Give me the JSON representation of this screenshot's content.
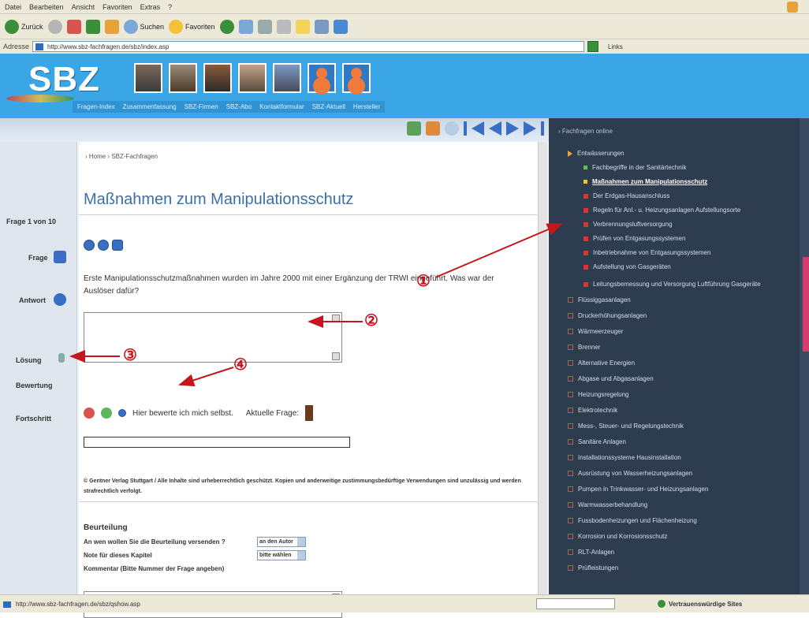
{
  "browser": {
    "menu_items": [
      "Datei",
      "Bearbeiten",
      "Ansicht",
      "Favoriten",
      "Extras",
      "?"
    ],
    "toolbar": {
      "back_label": "Zurück",
      "search_label": "Suchen",
      "favorites_label": "Favoriten"
    },
    "address_label": "Adresse",
    "address_value": "http://www.sbz-fachfragen.de/sbz/index.asp",
    "links_label": "Links",
    "status_url": "http://www.sbz-fachfragen.de/sbz/qshow.asp",
    "status_zone": "Vertrauenswürdige Sites"
  },
  "header": {
    "logo": "SBZ",
    "nav": [
      "Fragen-Index",
      "Zusammenfassung",
      "SBZ-Firmen",
      "SBZ-Abo",
      "Kontaktformular",
      "SBZ-Aktuell",
      "Hersteller"
    ]
  },
  "content": {
    "breadcrumb": "› Home › SBZ-Fachfragen",
    "title": "Maßnahmen zum Manipulationsschutz",
    "question_counter": "Frage 1 von 10",
    "label_question": "Frage",
    "label_answer": "Antwort",
    "label_solution": "Lösung",
    "label_rating": "Bewertung",
    "label_progress": "Fortschritt",
    "question_text": "Erste Manipulationsschutzmaßnahmen wurden im Jahre 2000 mit einer Ergänzung der TRWI eingeführt. Was war der Auslöser dafür?",
    "self_rate_label": "Hier bewerte ich mich selbst.",
    "current_question_label": "Aktuelle Frage:",
    "progress_fraction": 0.0,
    "copyright": "© Gentner Verlag Stuttgart / Alle Inhalte sind urheberrechtlich geschützt. Kopien und anderweitige zustimmungsbedürftige Verwendungen sind unzulässig und werden strafrechtlich verfolgt.",
    "feedback": {
      "title": "Beurteilung",
      "row1_label": "An wen wollen Sie die Beurteilung versenden ?",
      "row1_value": "an den Autor",
      "row2_label": "Note für dieses Kapitel",
      "row2_value": "bitte wählen",
      "comment_label": "Kommentar (Bitte Nummer der Frage angeben)"
    }
  },
  "right_panel": {
    "header": "› Fachfragen online",
    "items": [
      {
        "label": "Entwässerungen",
        "type": "arrow"
      },
      {
        "label": "Fachbegriffe in der Sanitärtechnik",
        "type": "green"
      },
      {
        "label": "Maßnahmen zum Manipulationsschutz",
        "type": "yellow",
        "active": true
      },
      {
        "label": "Der Erdgas-Hausanschluss",
        "type": "bullet"
      },
      {
        "label": "Regeln für Anl.- u. Heizungsanlagen Aufstellungsorte",
        "type": "bullet"
      },
      {
        "label": "Verbrennungsluftversorgung",
        "type": "bullet"
      },
      {
        "label": "Prüfen von Entgasungssystemen",
        "type": "bullet"
      },
      {
        "label": "Inbetriebnahme von Entgasungssystemen",
        "type": "bullet"
      },
      {
        "label": "Aufstellung von Gasgeräten",
        "type": "bullet"
      },
      {
        "label": "Leitungsbemessung und Versorgung Luftführung Gasgeräte",
        "type": "bullet"
      },
      {
        "label": "Flüssiggasanlagen",
        "type": "box"
      },
      {
        "label": "Druckerhöhungsanlagen",
        "type": "box"
      },
      {
        "label": "Wärmeerzeuger",
        "type": "box"
      },
      {
        "label": "Brenner",
        "type": "box"
      },
      {
        "label": "Alternative Energien",
        "type": "box"
      },
      {
        "label": "Abgase und Abgasanlagen",
        "type": "box"
      },
      {
        "label": "Heizungsregelung",
        "type": "box"
      },
      {
        "label": "Elektrotechnik",
        "type": "box"
      },
      {
        "label": "Mess-, Steuer- und Regelungstechnik",
        "type": "box"
      },
      {
        "label": "Sanitäre Anlagen",
        "type": "box"
      },
      {
        "label": "Installationssysteme Hausinstallation",
        "type": "box"
      },
      {
        "label": "Ausrüstung von Wasserheizungsanlagen",
        "type": "box"
      },
      {
        "label": "Pumpen in Trinkwasser- und Heizungsanlagen",
        "type": "box"
      },
      {
        "label": "Warmwasserbehandlung",
        "type": "box"
      },
      {
        "label": "Fussbodenheizungen und Flächenheizung",
        "type": "box"
      },
      {
        "label": "Korrosion und Korrosionsschutz",
        "type": "box"
      },
      {
        "label": "RLT-Anlagen",
        "type": "box"
      },
      {
        "label": "Prüfleistungen",
        "type": "box"
      }
    ]
  },
  "annotations": [
    "①",
    "②",
    "③",
    "④"
  ],
  "colors": {
    "header_blue": "#3aa6e6",
    "title_blue": "#3b6fa8",
    "panel_bg": "#2e3c4f",
    "annotation_red": "#c4161c"
  }
}
